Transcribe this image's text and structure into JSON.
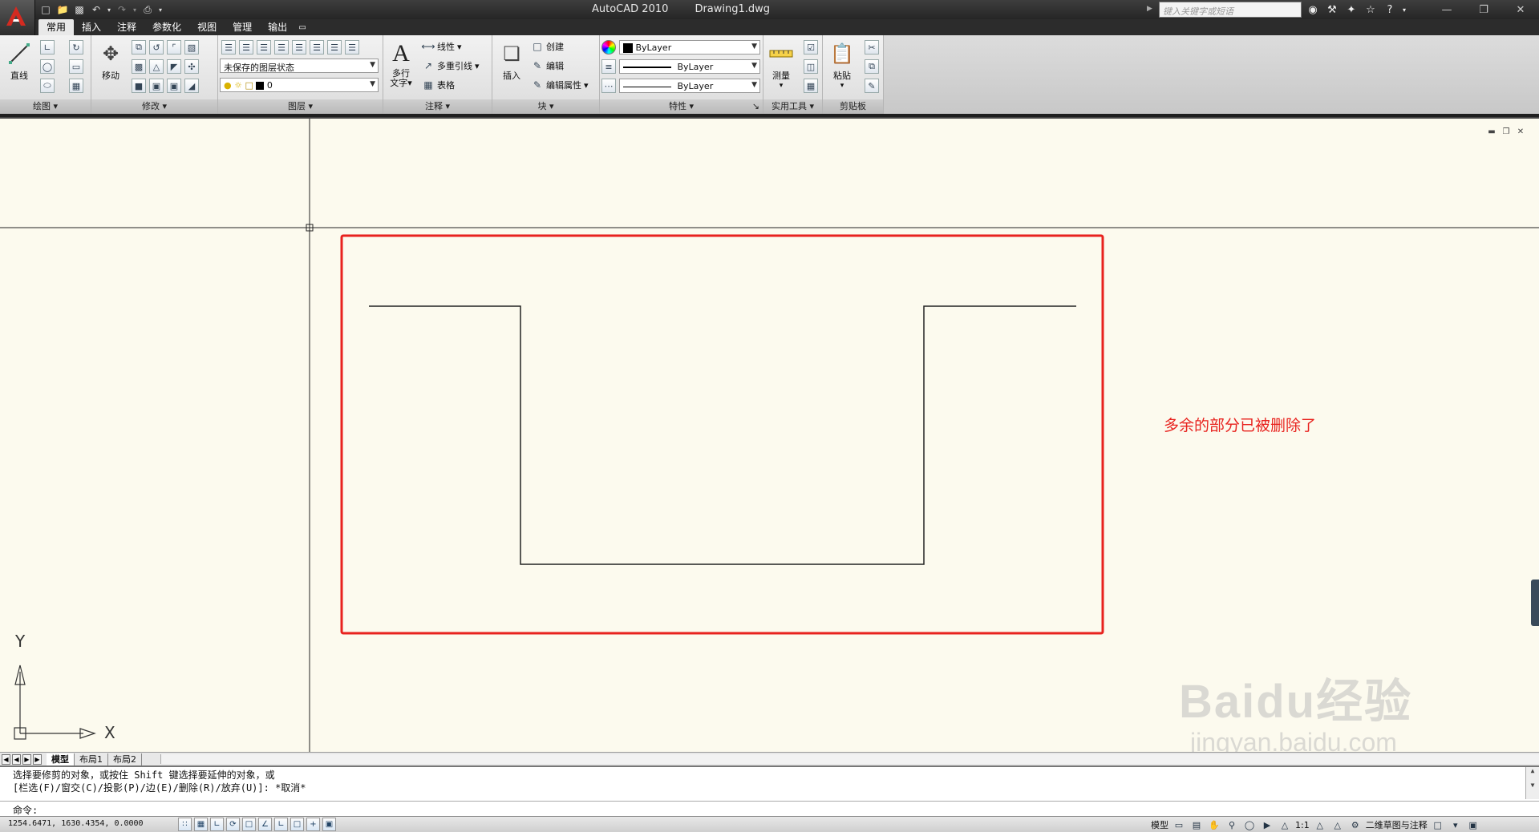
{
  "title": {
    "app_name": "AutoCAD 2010",
    "document": "Drawing1.dwg"
  },
  "search": {
    "placeholder": "键入关键字或短语"
  },
  "ribbon": {
    "tabs": [
      "常用",
      "插入",
      "注释",
      "参数化",
      "视图",
      "管理",
      "输出"
    ],
    "active_tab": "常用",
    "panels": {
      "draw": {
        "label": "绘图",
        "line": "直线"
      },
      "modify": {
        "label": "修改",
        "move": "移动"
      },
      "layers": {
        "label": "图层",
        "layer_state": "未保存的图层状态",
        "current_layer": "0"
      },
      "annotation": {
        "label": "注释",
        "mtext_line1": "多行",
        "mtext_line2": "文字",
        "linear": "线性",
        "mleader": "多重引线",
        "table": "表格"
      },
      "block": {
        "label": "块",
        "insert": "插入",
        "create": "创建",
        "edit": "编辑",
        "edit_attr": "编辑属性"
      },
      "properties": {
        "label": "特性",
        "color": "ByLayer",
        "linetype": "ByLayer",
        "lineweight": "ByLayer"
      },
      "utilities": {
        "label": "实用工具",
        "measure": "测量"
      },
      "clipboard": {
        "label": "剪贴板",
        "paste": "粘贴"
      }
    }
  },
  "canvas": {
    "annotation_text": "多余的部分已被删除了",
    "annotation_color": "#e8221e",
    "background": "#fcfaee",
    "ucs_x": "X",
    "ucs_y": "Y"
  },
  "layout_tabs": [
    "模型",
    "布局1",
    "布局2"
  ],
  "command": {
    "history": [
      "选择要修剪的对象，或按住 Shift 键选择要延伸的对象，或",
      "[栏选(F)/窗交(C)/投影(P)/边(E)/删除(R)/放弃(U)]: *取消*"
    ],
    "prompt": "命令:"
  },
  "status": {
    "coordinates": "1254.6471, 1630.4354, 0.0000",
    "model": "模型",
    "scale": "1:1",
    "workspace": "二维草图与注释"
  },
  "watermark": {
    "brand": "Baidu经验",
    "url": "jingyan.baidu.com"
  }
}
